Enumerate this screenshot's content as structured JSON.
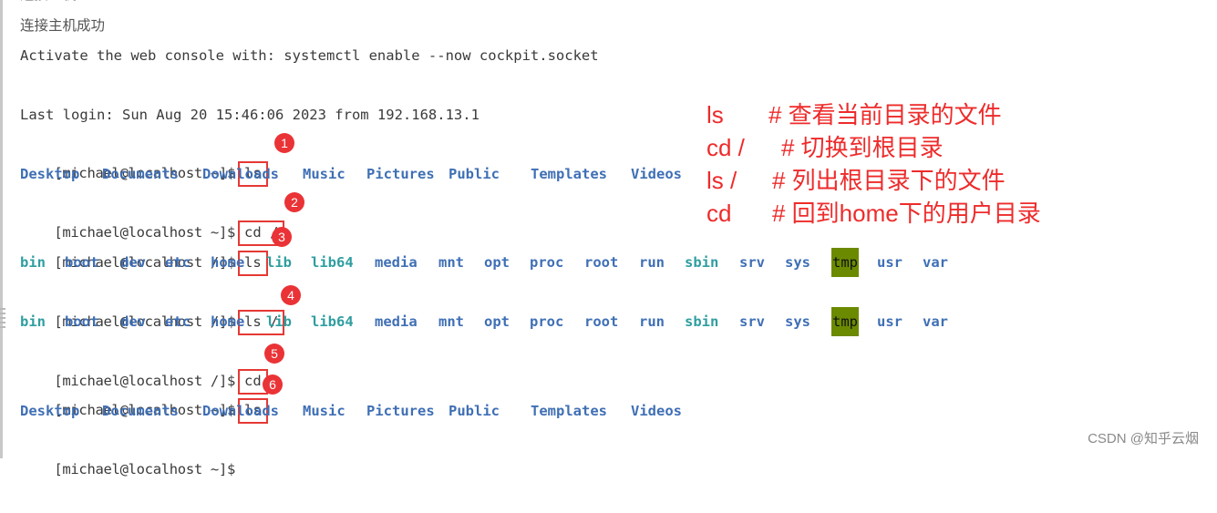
{
  "terminal": {
    "header_cut": "连接主机...",
    "connected": "连接主机成功",
    "activate_msg": "Activate the web console with: systemctl enable --now cockpit.socket",
    "last_login": "Last login: Sun Aug 20 15:46:06 2023 from 192.168.13.1",
    "commands": [
      {
        "prompt": "[michael@localhost ~]$",
        "cmd": "ls",
        "badge": "1"
      },
      {
        "prompt": "[michael@localhost ~]$",
        "cmd": "cd /",
        "badge": "2"
      },
      {
        "prompt": "[michael@localhost /]$",
        "cmd": "ls",
        "badge": "3"
      },
      {
        "prompt": "[michael@localhost /]$",
        "cmd": "ls /",
        "badge": "4"
      },
      {
        "prompt": "[michael@localhost /]$",
        "cmd": "cd",
        "badge": "5"
      },
      {
        "prompt": "[michael@localhost ~]$",
        "cmd": "ls",
        "badge": "6"
      }
    ],
    "final_prompt": "[michael@localhost ~]$",
    "home_listing": [
      "Desktop",
      "Documents",
      "Downloads",
      "Music",
      "Pictures",
      "Public",
      "Templates",
      "Videos"
    ],
    "root_listing": [
      {
        "name": "bin",
        "type": "link"
      },
      {
        "name": "boot",
        "type": "dir"
      },
      {
        "name": "dev",
        "type": "dir"
      },
      {
        "name": "etc",
        "type": "dir"
      },
      {
        "name": "home",
        "type": "dir"
      },
      {
        "name": "lib",
        "type": "link"
      },
      {
        "name": "lib64",
        "type": "link"
      },
      {
        "name": "media",
        "type": "dir"
      },
      {
        "name": "mnt",
        "type": "dir"
      },
      {
        "name": "opt",
        "type": "dir"
      },
      {
        "name": "proc",
        "type": "dir"
      },
      {
        "name": "root",
        "type": "dir"
      },
      {
        "name": "run",
        "type": "dir"
      },
      {
        "name": "sbin",
        "type": "link"
      },
      {
        "name": "srv",
        "type": "dir"
      },
      {
        "name": "sys",
        "type": "dir"
      },
      {
        "name": "tmp",
        "type": "sticky"
      },
      {
        "name": "usr",
        "type": "dir"
      },
      {
        "name": "var",
        "type": "dir"
      }
    ]
  },
  "annotations": [
    {
      "cmd": "ls",
      "comment": "# 查看当前目录的文件"
    },
    {
      "cmd": "cd /",
      "comment": "# 切换到根目录"
    },
    {
      "cmd": "ls /",
      "comment": "# 列出根目录下的文件"
    },
    {
      "cmd": "cd",
      "comment": "# 回到home下的用户目录"
    }
  ],
  "watermark": "CSDN @知乎云烟",
  "colors": {
    "dir": "#3f6fb5",
    "link": "#2f9ea0",
    "sticky_bg": "#6b8a00",
    "annotation": "#ee2b2b",
    "badge": "#ea3336"
  }
}
